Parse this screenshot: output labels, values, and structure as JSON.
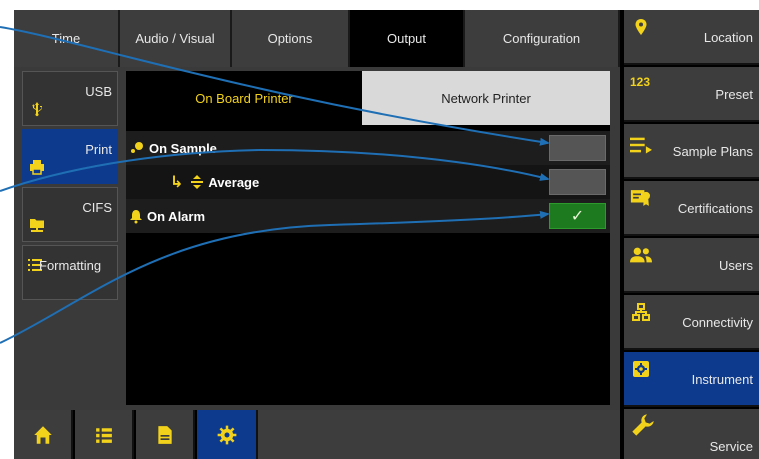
{
  "top_tabs": [
    {
      "label": "Time"
    },
    {
      "label": "Audio / Visual"
    },
    {
      "label": "Options"
    },
    {
      "label": "Output",
      "active": true
    },
    {
      "label": "Configuration"
    }
  ],
  "side_tabs": [
    {
      "label": "USB",
      "icon": "usb-icon"
    },
    {
      "label": "Print",
      "icon": "printer-icon",
      "active": true
    },
    {
      "label": "CIFS",
      "icon": "network-folder-icon"
    },
    {
      "label": "Formatting",
      "icon": "list-format-icon"
    }
  ],
  "sub_tabs": {
    "on_board": "On Board Printer",
    "network": "Network Printer"
  },
  "options": [
    {
      "label": "On Sample",
      "icon": "sample-icon",
      "checked": false
    },
    {
      "label": "Average",
      "prefix": "↳",
      "icon": "average-icon",
      "checked": false
    },
    {
      "label": "On Alarm",
      "icon": "alarm-bell-icon",
      "checked": true,
      "check_glyph": "✓"
    }
  ],
  "bottom_nav": [
    {
      "icon": "home-icon"
    },
    {
      "icon": "list-icon"
    },
    {
      "icon": "document-icon"
    },
    {
      "icon": "gear-icon",
      "active": true
    }
  ],
  "right_nav": [
    {
      "label": "Location",
      "icon": "location-pin-icon"
    },
    {
      "label": "Preset",
      "icon": "preset-123-icon",
      "icon_text": "123"
    },
    {
      "label": "Sample Plans",
      "icon": "sample-plans-icon"
    },
    {
      "label": "Certifications",
      "icon": "certificate-icon"
    },
    {
      "label": "Users",
      "icon": "users-icon"
    },
    {
      "label": "Connectivity",
      "icon": "connectivity-icon"
    },
    {
      "label": "Instrument",
      "icon": "instrument-icon",
      "active": true
    },
    {
      "label": "Service",
      "icon": "wrench-icon"
    }
  ],
  "colors": {
    "accent_yellow": "#f2d21b",
    "active_blue": "#0d3a8c",
    "checked_green": "#1e7a1e",
    "callout_line": "#1f6fb5"
  }
}
